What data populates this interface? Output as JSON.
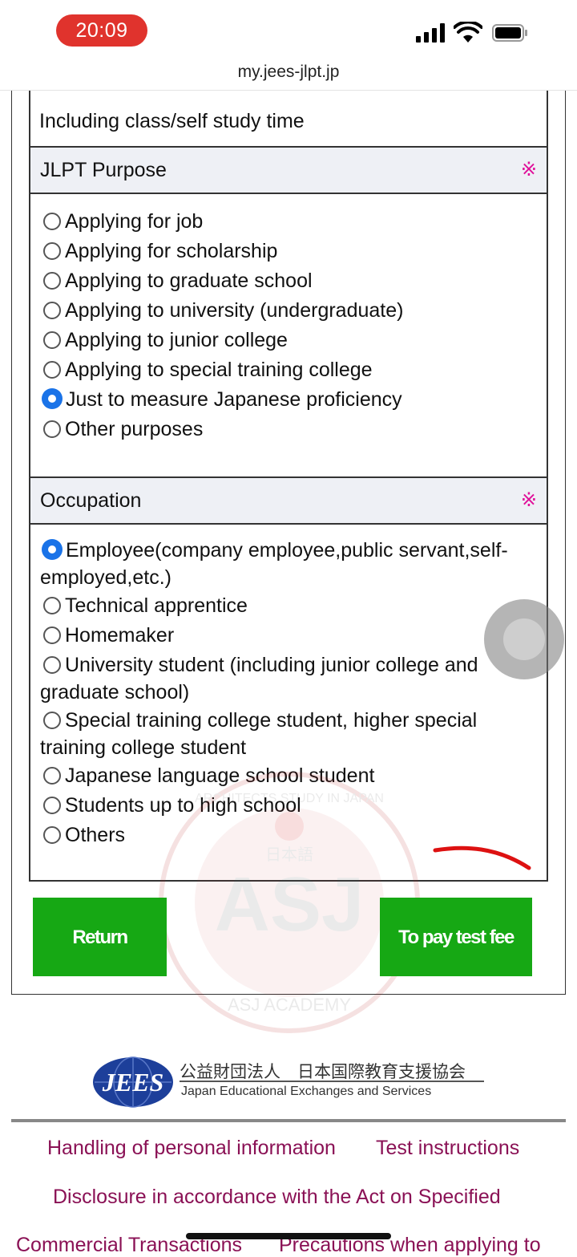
{
  "status_bar": {
    "time": "20:09"
  },
  "browser": {
    "url": "my.jees-jlpt.jp"
  },
  "study_time": {
    "note": "Including class/self study time"
  },
  "jlpt_purpose": {
    "heading": "JLPT Purpose",
    "required_mark": "※",
    "options": [
      {
        "label": "Applying for job",
        "selected": false
      },
      {
        "label": "Applying for scholarship",
        "selected": false
      },
      {
        "label": "Applying to graduate school",
        "selected": false
      },
      {
        "label": "Applying to university (undergraduate)",
        "selected": false
      },
      {
        "label": "Applying to junior college",
        "selected": false
      },
      {
        "label": "Applying to special training college",
        "selected": false
      },
      {
        "label": "Just to measure Japanese proficiency",
        "selected": true
      },
      {
        "label": "Other purposes",
        "selected": false
      }
    ]
  },
  "occupation": {
    "heading": "Occupation",
    "required_mark": "※",
    "options": [
      {
        "label": "Employee(company employee,public servant,self-employed,etc.)",
        "selected": true
      },
      {
        "label": "Technical apprentice",
        "selected": false
      },
      {
        "label": "Homemaker",
        "selected": false
      },
      {
        "label": "University student (including junior college and graduate school)",
        "selected": false
      },
      {
        "label": "Special training college student, higher special training college student",
        "selected": false
      },
      {
        "label": "Japanese language school student",
        "selected": false
      },
      {
        "label": "Students up to high school",
        "selected": false
      },
      {
        "label": "Others",
        "selected": false
      }
    ]
  },
  "actions": {
    "return_label": "Return",
    "pay_label": "To pay test fee"
  },
  "watermark": {
    "text": "ASJ",
    "ring_top": "ARCHITECTS STUDY IN JAPAN",
    "ring_bottom": "ASJ ACADEMY",
    "kanji": "日本語"
  },
  "footer": {
    "logo_mark": "JEES",
    "org_name_ja": "公益財団法人　日本国際教育支援協会",
    "org_name_en": "Japan Educational Exchanges and Services",
    "links": [
      "Handling of personal information",
      "Test instructions",
      "Disclosure in accordance with the Act on Specified",
      "Commercial Transactions",
      "Precautions when applying to"
    ]
  },
  "colors": {
    "button_green": "#16a814",
    "required_pink": "#e0119a",
    "link_purple": "#8a1155",
    "radio_blue": "#1a73e8",
    "time_pill": "#e0332d"
  }
}
